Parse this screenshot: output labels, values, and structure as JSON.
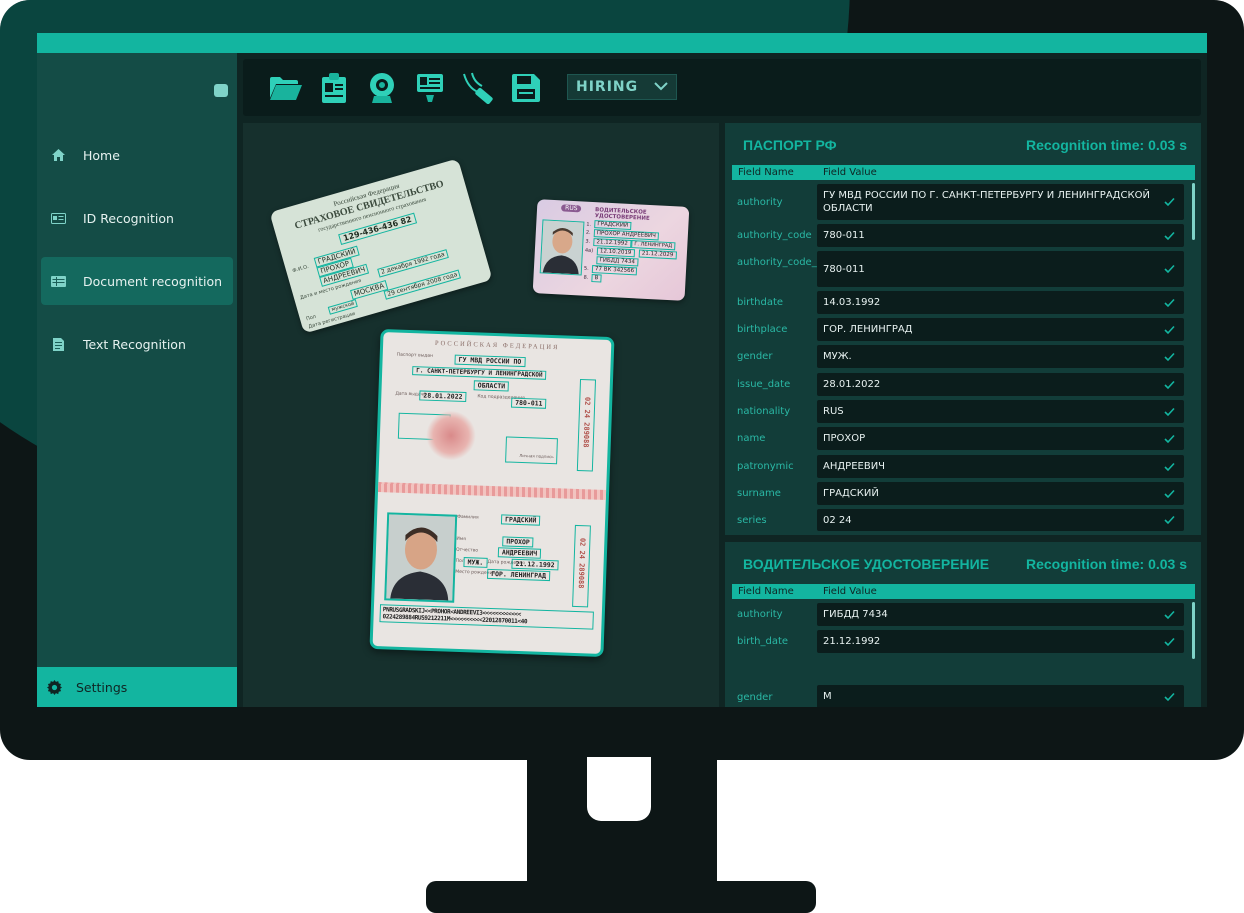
{
  "toolbar": {
    "icons": [
      "folder-open-icon",
      "clipboard-id-icon",
      "webcam-icon",
      "id-card-scan-icon",
      "scanner-wand-icon",
      "save-icon"
    ],
    "dropdown_value": "HIRING"
  },
  "sidebar": {
    "items": [
      {
        "label": "Home",
        "icon": "home-icon"
      },
      {
        "label": "ID Recognition",
        "icon": "id-card-icon"
      },
      {
        "label": "Document recognition",
        "icon": "document-table-icon",
        "active": true
      },
      {
        "label": "Text Recognition",
        "icon": "text-document-icon"
      }
    ],
    "settings_label": "Settings"
  },
  "documents": {
    "insurance": {
      "header1": "Российская Федерация",
      "header2": "СТРАХОВОЕ СВИДЕТЕЛЬСТВО",
      "header3": "государственного пенсионного страхования",
      "number": "129-436-436 82",
      "surname": "ГРАДСКИЙ",
      "name": "ПРОХОР",
      "patronymic": "АНДРЕЕВИЧ",
      "birth_date": "2 декабря 1992 года",
      "birth_place": "МОСКВА",
      "gender": "мужской",
      "reg_date": "29 сентября 2008 года",
      "lbl_fio": "Ф.И.О.",
      "lbl_birth": "Дата и место рождения",
      "lbl_gender": "Пол",
      "lbl_reg": "Дата регистрации"
    },
    "license": {
      "badge": "RUS",
      "title": "ВОДИТЕЛЬСКОЕ УДОСТОВЕРЕНИЕ",
      "n1": "1.",
      "n2": "2.",
      "n3": "3.",
      "n4": "4а)",
      "n5": "5.",
      "n8": "8.",
      "surname": "ГРАДСКИЙ",
      "name": "ПРОХОР АНДРЕЕВИЧ",
      "birth": "21.12.1992",
      "place": "Г. ЛЕНИНГРАД",
      "issue": "12.10.2019",
      "expire": "21.12.2029",
      "authority": "ГИБДД 7434",
      "number": "77 ВК 342566",
      "cat": "В"
    },
    "passport": {
      "header": "РОССИЙСКАЯ ФЕДЕРАЦИЯ",
      "lbl_issued": "Паспорт выдан",
      "authority1": "ГУ МВД РОССИИ ПО",
      "authority2": "Г. САНКТ-ПЕТЕРБУРГУ И ЛЕНИНГРАДСКОЙ",
      "authority3": "ОБЛАСТИ",
      "lbl_date": "Дата выдачи",
      "issue_date": "28.01.2022",
      "lbl_code": "Код подразделения",
      "code": "780-011",
      "lbl_sign": "Личная подпись",
      "series": "02 24 289088",
      "surname": "ГРАДСКИЙ",
      "name": "ПРОХОР",
      "patronymic": "АНДРЕЕВИЧ",
      "gender": "МУЖ.",
      "birthdate": "21.12.1992",
      "birthplace": "ГОР. ЛЕНИНГРАД",
      "lbl_surname": "Фамилия",
      "lbl_name": "Имя",
      "lbl_patronymic": "Отчество",
      "lbl_gender": "Пол",
      "lbl_birthdate": "Дата рождения",
      "lbl_birthplace": "Место рождения",
      "mrz1": "PNRUSGRADSKIJ<<PROHOR<ANDREEVI3<<<<<<<<<<<<",
      "mrz2": "0224289884RUS9212211M<<<<<<<<<<22012870011<40"
    }
  },
  "panel1": {
    "title": "ПАСПОРТ РФ",
    "time": "Recognition time: 0.03 s",
    "col1": "Field Name",
    "col2": "Field Value",
    "rows": [
      {
        "name": "authority",
        "value": "ГУ МВД РОССИИ ПО Г. САНКТ-ПЕТЕРБУРГУ И ЛЕНИНГРАДСКОЙ ОБЛАСТИ"
      },
      {
        "name": "authority_code",
        "value": "780-011"
      },
      {
        "name": "authority_code_mrz",
        "value": "780-011"
      },
      {
        "name": "birthdate",
        "value": "14.03.1992"
      },
      {
        "name": "birthplace",
        "value": "ГОР. ЛЕНИНГРАД"
      },
      {
        "name": "gender",
        "value": "МУЖ."
      },
      {
        "name": "issue_date",
        "value": "28.01.2022"
      },
      {
        "name": "nationality",
        "value": "RUS"
      },
      {
        "name": "name",
        "value": "ПРОХОР"
      },
      {
        "name": "patronymic",
        "value": "АНДРЕЕВИЧ"
      },
      {
        "name": "surname",
        "value": "ГРАДСКИЙ"
      },
      {
        "name": "series",
        "value": "02 24"
      }
    ]
  },
  "panel2": {
    "title": "ВОДИТЕЛЬСКОЕ УДОСТОВЕРЕНИЕ",
    "time": "Recognition time: 0.03 s",
    "col1": "Field Name",
    "col2": "Field Value",
    "rows": [
      {
        "name": "authority",
        "value": "ГИБДД 7434"
      },
      {
        "name": "birth_date",
        "value": "21.12.1992"
      },
      {
        "name": "gender",
        "value": "M"
      }
    ]
  },
  "colors": {
    "accent": "#13b5a0",
    "dark": "#0f2523",
    "field": "#0b1d1c",
    "label": "#2ab8a5"
  }
}
